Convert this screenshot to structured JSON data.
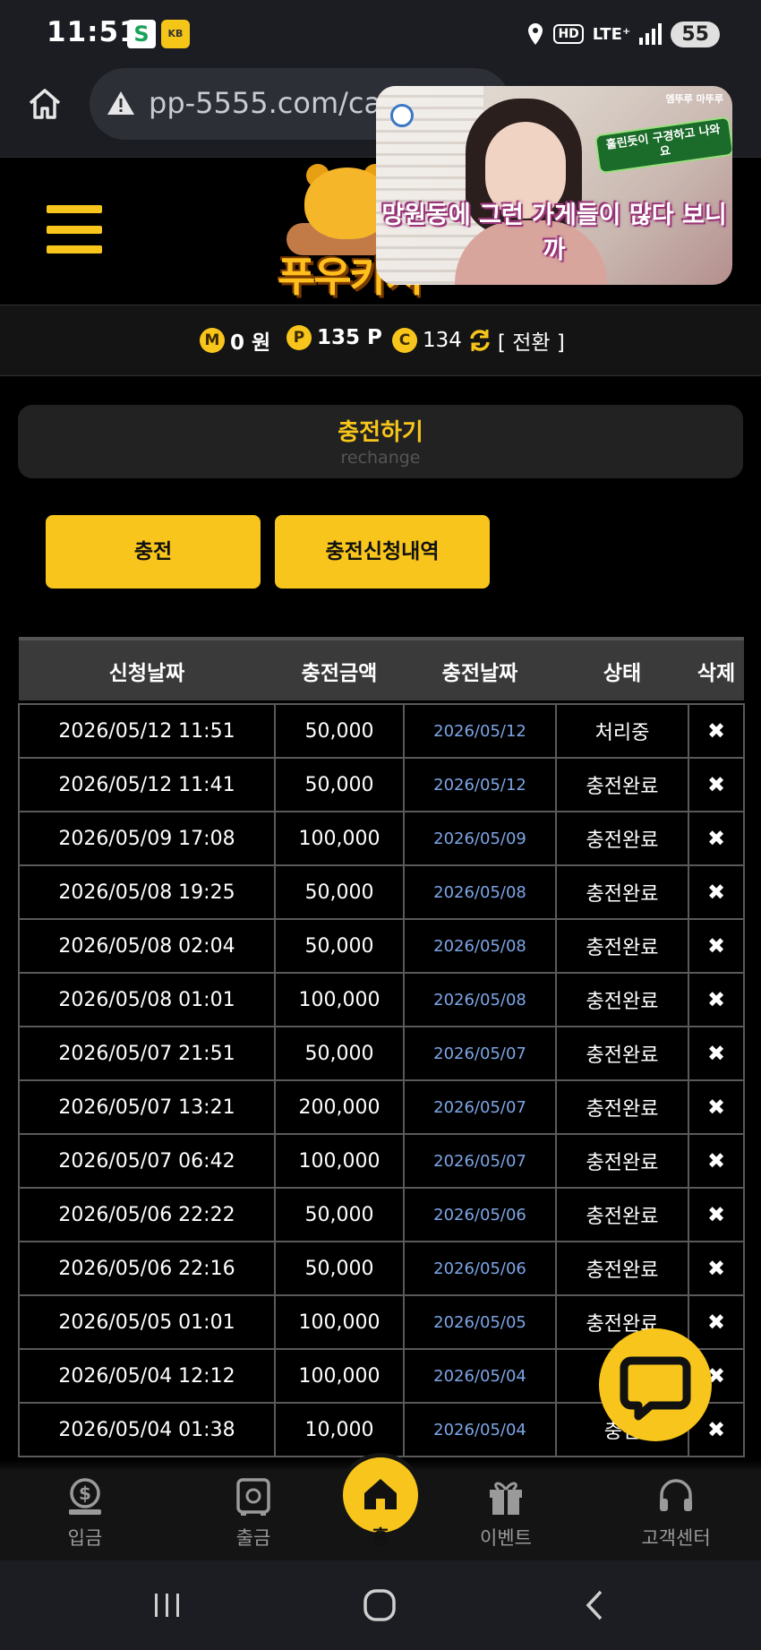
{
  "status_bar": {
    "time": "11:51",
    "lte": "LTE⁺",
    "hd": "HD",
    "battery": "55",
    "app_icons": [
      "S",
      "KB"
    ]
  },
  "browser": {
    "url": "pp-5555.com/cas"
  },
  "video_overlay": {
    "caption": "망원동에 그런 가게들이 많다 보니까",
    "badge": "훌린듯이 구경하고 나와요",
    "tag": "엠뚜루 마뚜루"
  },
  "site": {
    "logo_text": "푸우카지노"
  },
  "balance": {
    "money_icon": "M",
    "money_value": "0 원",
    "point_icon": "P",
    "point_value": "135 P",
    "coin_icon": "C",
    "coin_value": "134",
    "switch_label": "[ 전환 ]"
  },
  "page": {
    "title": "충전하기",
    "subtitle": "rechange"
  },
  "buttons": {
    "charge": "충전",
    "history": "충전신청내역"
  },
  "table": {
    "headers": [
      "신청날짜",
      "충전금액",
      "충전날짜",
      "상태",
      "삭제"
    ],
    "delete_symbol": "✖",
    "rows": [
      {
        "request": "2026/05/12 11:51",
        "amount": "50,000",
        "date": "2026/05/12",
        "status": "처리중"
      },
      {
        "request": "2026/05/12 11:41",
        "amount": "50,000",
        "date": "2026/05/12",
        "status": "충전완료"
      },
      {
        "request": "2026/05/09 17:08",
        "amount": "100,000",
        "date": "2026/05/09",
        "status": "충전완료"
      },
      {
        "request": "2026/05/08 19:25",
        "amount": "50,000",
        "date": "2026/05/08",
        "status": "충전완료"
      },
      {
        "request": "2026/05/08 02:04",
        "amount": "50,000",
        "date": "2026/05/08",
        "status": "충전완료"
      },
      {
        "request": "2026/05/08 01:01",
        "amount": "100,000",
        "date": "2026/05/08",
        "status": "충전완료"
      },
      {
        "request": "2026/05/07 21:51",
        "amount": "50,000",
        "date": "2026/05/07",
        "status": "충전완료"
      },
      {
        "request": "2026/05/07 13:21",
        "amount": "200,000",
        "date": "2026/05/07",
        "status": "충전완료"
      },
      {
        "request": "2026/05/07 06:42",
        "amount": "100,000",
        "date": "2026/05/07",
        "status": "충전완료"
      },
      {
        "request": "2026/05/06 22:22",
        "amount": "50,000",
        "date": "2026/05/06",
        "status": "충전완료"
      },
      {
        "request": "2026/05/06 22:16",
        "amount": "50,000",
        "date": "2026/05/06",
        "status": "충전완료"
      },
      {
        "request": "2026/05/05 01:01",
        "amount": "100,000",
        "date": "2026/05/05",
        "status": "충전완료"
      },
      {
        "request": "2026/05/04 12:12",
        "amount": "100,000",
        "date": "2026/05/04",
        "status": "충"
      },
      {
        "request": "2026/05/04 01:38",
        "amount": "10,000",
        "date": "2026/05/04",
        "status": "충전"
      }
    ]
  },
  "bottom_nav": {
    "deposit": "입금",
    "withdraw": "출금",
    "home": "홈",
    "event": "이벤트",
    "support": "고객센터"
  },
  "colors": {
    "accent": "#f7c51b",
    "date_link": "#7da5e6",
    "background": "#000000"
  }
}
